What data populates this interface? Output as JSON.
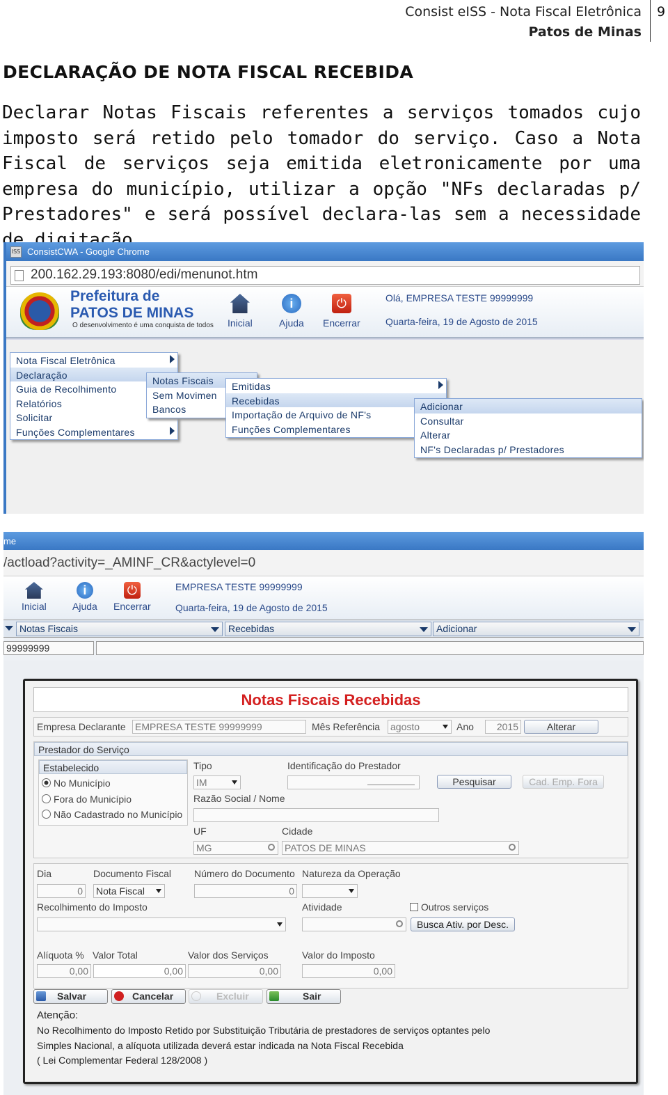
{
  "page_header": {
    "title": "Consist eISS - Nota Fiscal Eletrônica",
    "city": "Patos de Minas",
    "page_number": "9"
  },
  "section": {
    "heading": "DECLARAÇÃO DE NOTA FISCAL RECEBIDA",
    "paragraph": "Declarar Notas Fiscais referentes a serviços tomados cujo imposto será retido pelo tomador do serviço. Caso a Nota Fiscal de serviços seja emitida eletronicamente por uma empresa do município, utilizar a opção \"NFs declaradas p/ Prestadores\" e será possível declara-las sem a necessidade de digitação."
  },
  "screenshot1": {
    "window_title": "ConsistCWA - Google Chrome",
    "favicon": "ISS",
    "url": "200.162.29.193:8080/edi/menunot.htm",
    "brand": {
      "line1": "Prefeitura de",
      "line2": "PATOS DE MINAS",
      "slogan": "O desenvolvimento é uma conquista de todos"
    },
    "toolbar": {
      "home": "Inicial",
      "help": "Ajuda",
      "exit": "Encerrar",
      "info_glyph": "i",
      "power_glyph": "⏻"
    },
    "greeting": "Olá, EMPRESA TESTE 99999999",
    "date": "Quarta-feira, 19 de Agosto de 2015",
    "menu_main": [
      "Nota Fiscal Eletrônica",
      "Declaração",
      "Guia de Recolhimento",
      "Relatórios",
      "Solicitar",
      "Funções Complementares"
    ],
    "menu_decl": [
      "Notas Fiscais",
      "Sem Movimen",
      "Bancos"
    ],
    "menu_notas": [
      "Emitidas",
      "Recebidas",
      "Importação de Arquivo de NF's",
      "Funções Complementares"
    ],
    "menu_recebidas": [
      "Adicionar",
      "Consultar",
      "Alterar",
      "NF's Declaradas p/ Prestadores"
    ]
  },
  "screenshot2": {
    "title_fragment": "me",
    "url_fragment": "/actload?activity=_AMINF_CR&actylevel=0",
    "toolbar": {
      "home": "Inicial",
      "help": "Ajuda",
      "exit": "Encerrar"
    },
    "company": "EMPRESA TESTE 99999999",
    "date": "Quarta-feira, 19 de Agosto de 2015",
    "nav": [
      "Notas Fiscais",
      "Recebidas",
      "Adicionar"
    ],
    "id_value": "99999999"
  },
  "form": {
    "title": "Notas Fiscais Recebidas",
    "empresa_label": "Empresa Declarante",
    "empresa_value": "EMPRESA TESTE 99999999",
    "mes_label": "Mês Referência",
    "mes_value": "agosto",
    "ano_label": "Ano",
    "ano_value": "2015",
    "alterar": "Alterar",
    "prestador_header": "Prestador do Serviço",
    "estab_header": "Estabelecido",
    "radio_options": [
      "No Município",
      "Fora do Município",
      "Não Cadastrado no Município"
    ],
    "tipo_label": "Tipo",
    "tipo_value": "IM",
    "ident_label": "Identificação do Prestador",
    "pesquisar": "Pesquisar",
    "cad_emp": "Cad. Emp. Fora",
    "razao_label": "Razão Social / Nome",
    "uf_label": "UF",
    "uf_value": "MG",
    "cidade_label": "Cidade",
    "cidade_value": "PATOS DE MINAS",
    "dia_label": "Dia",
    "dia_value": "0",
    "doc_label": "Documento Fiscal",
    "doc_value": "Nota Fiscal",
    "num_label": "Número do Documento",
    "num_value": "0",
    "natureza_label": "Natureza da Operação",
    "recolh_label": "Recolhimento do Imposto",
    "atividade_label": "Atividade",
    "outros_label": "Outros serviços",
    "busca_label": "Busca Ativ. por Desc.",
    "aliquota_label": "Alíquota %",
    "aliquota_value": "0,00",
    "total_label": "Valor Total",
    "total_value": "0,00",
    "servicos_label": "Valor dos Serviços",
    "servicos_value": "0,00",
    "imposto_label": "Valor do Imposto",
    "imposto_value": "0,00",
    "buttons": {
      "save": "Salvar",
      "cancel": "Cancelar",
      "delete": "Excluir",
      "exit": "Sair"
    },
    "attention_title": "Atenção:",
    "attention_lines": [
      "No Recolhimento do Imposto Retido por Substituição Tributária de prestadores de serviços optantes pelo",
      "Simples Nacional, a alíquota utilizada deverá estar indicada na Nota Fiscal Recebida",
      "( Lei Complementar Federal 128/2008 )"
    ]
  }
}
